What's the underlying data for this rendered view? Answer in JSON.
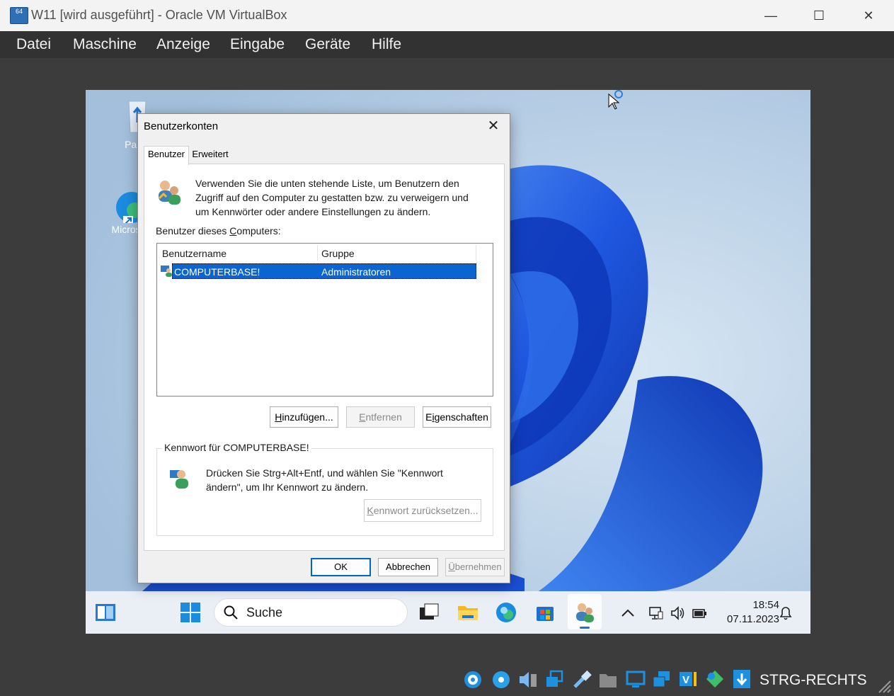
{
  "host": {
    "title": "W11 [wird ausgeführt] - Oracle VM VirtualBox",
    "title_icon_text": "64",
    "window_buttons": {
      "minimize": "—",
      "maximize": "☐",
      "close": "✕"
    },
    "menu": [
      "Datei",
      "Maschine",
      "Anzeige",
      "Eingabe",
      "Geräte",
      "Hilfe"
    ],
    "status_host_key": "STRG-RECHTS",
    "status_icons": [
      "hard-disk-icon",
      "optical-drive-icon",
      "audio-icon",
      "network-icon",
      "usb-icon",
      "shared-folders-icon",
      "display-icon",
      "recording-icon",
      "vt-x-icon",
      "cpu-load-icon",
      "mouse-integration-icon",
      "keyboard-capture-icon"
    ]
  },
  "guest": {
    "desktop_icons": [
      {
        "label": "Papie",
        "icon": "recycle-bin-icon"
      },
      {
        "label": "Microso",
        "icon": "edge-shortcut-icon"
      }
    ],
    "taskbar": {
      "search_label": "Suche",
      "clock_time": "18:54",
      "clock_date": "07.11.2023",
      "items": [
        "widgets-icon",
        "start-icon",
        "task-view-icon",
        "file-explorer-icon",
        "edge-icon",
        "store-icon",
        "user-accounts-icon"
      ],
      "tray": [
        "show-hidden-icon",
        "network-icon",
        "volume-icon",
        "battery-icon",
        "notification-icon"
      ]
    },
    "colors": {
      "wallpaper_bg": "#a8c3de",
      "bloom_dark": "#0b2d9c",
      "bloom_mid": "#1f57e0",
      "bloom_light": "#4a8cf2"
    }
  },
  "dialog": {
    "title": "Benutzerkonten",
    "close": "✕",
    "tabs": [
      "Benutzer",
      "Erweitert"
    ],
    "intro": [
      "Verwenden Sie die unten stehende Liste, um Benutzern den",
      "Zugriff auf den Computer zu gestatten bzw. zu verweigern und",
      "um Kennwörter oder andere Einstellungen zu ändern."
    ],
    "users_label_pre": "Benutzer dieses ",
    "users_label_u": "C",
    "users_label_post": "omputers:",
    "columns": [
      "Benutzername",
      "Gruppe"
    ],
    "rows": [
      {
        "username": "COMPUTERBASE!",
        "group": "Administratoren"
      }
    ],
    "buttons": {
      "add": {
        "u": "H",
        "rest": "inzufügen..."
      },
      "remove": {
        "u": "E",
        "rest": "ntfernen"
      },
      "properties": {
        "pre": "E",
        "u": "i",
        "rest": "genschaften"
      }
    },
    "password_group": {
      "label": "Kennwort für COMPUTERBASE!",
      "text": [
        "Drücken Sie Strg+Alt+Entf, und wählen Sie \"Kennwort",
        "ändern\", um Ihr Kennwort zu ändern."
      ],
      "reset": {
        "u": "K",
        "rest": "ennwort zurücksetzen..."
      }
    },
    "footer": {
      "ok": "OK",
      "cancel": "Abbrechen",
      "apply": {
        "u": "Ü",
        "rest": "bernehmen"
      }
    }
  }
}
